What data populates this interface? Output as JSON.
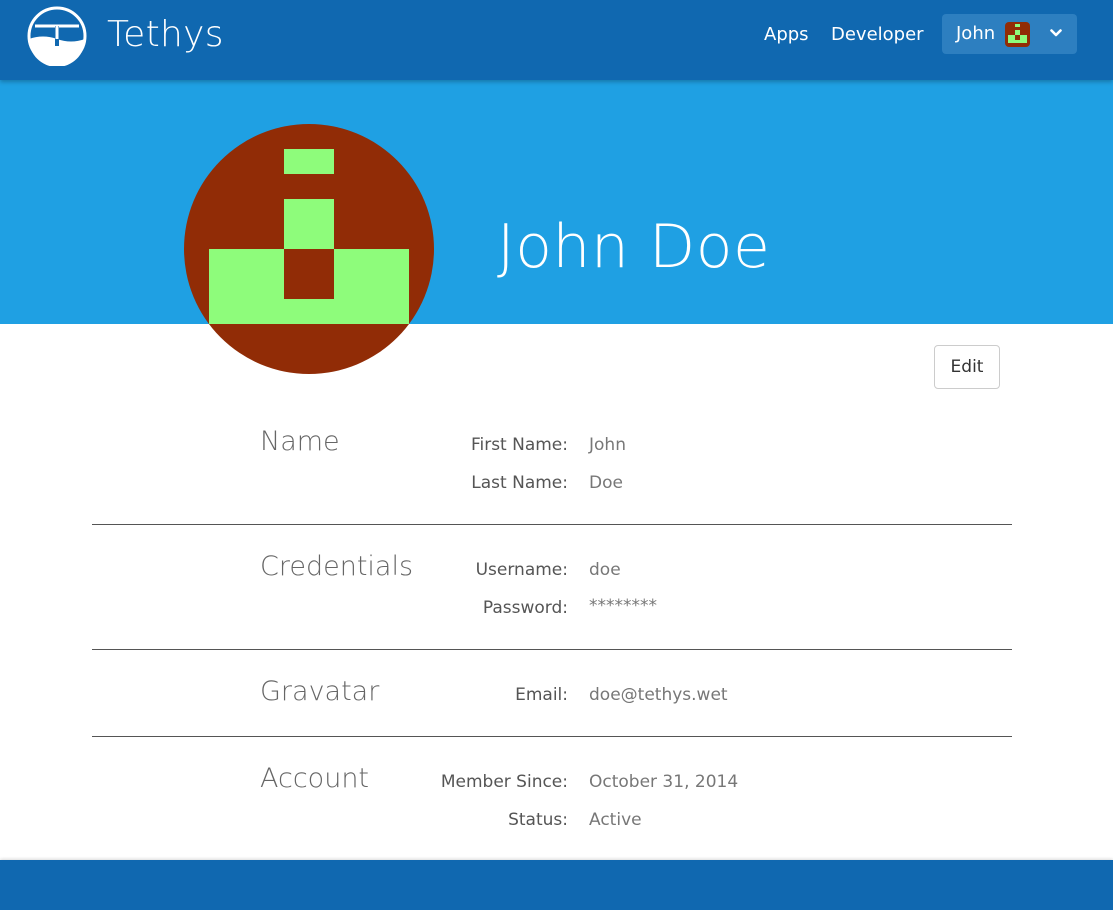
{
  "header": {
    "brand": "Tethys",
    "nav": {
      "apps": "Apps",
      "developer": "Developer"
    },
    "user_menu": {
      "name": "John"
    }
  },
  "profile": {
    "full_name": "John Doe"
  },
  "actions": {
    "edit_label": "Edit"
  },
  "sections": {
    "name": {
      "title": "Name",
      "first_name_label": "First Name:",
      "first_name": "John",
      "last_name_label": "Last Name:",
      "last_name": "Doe"
    },
    "credentials": {
      "title": "Credentials",
      "username_label": "Username:",
      "username": "doe",
      "password_label": "Password:",
      "password": "********"
    },
    "gravatar": {
      "title": "Gravatar",
      "email_label": "Email:",
      "email": "doe@tethys.wet"
    },
    "account": {
      "title": "Account",
      "member_since_label": "Member Since:",
      "member_since": "October 31, 2014",
      "status_label": "Status:",
      "status": "Active"
    }
  },
  "colors": {
    "header_bg": "#1068b0",
    "banner_bg": "#1fa0e3",
    "avatar_bg": "#912c06",
    "avatar_fg": "#8efc7b"
  }
}
